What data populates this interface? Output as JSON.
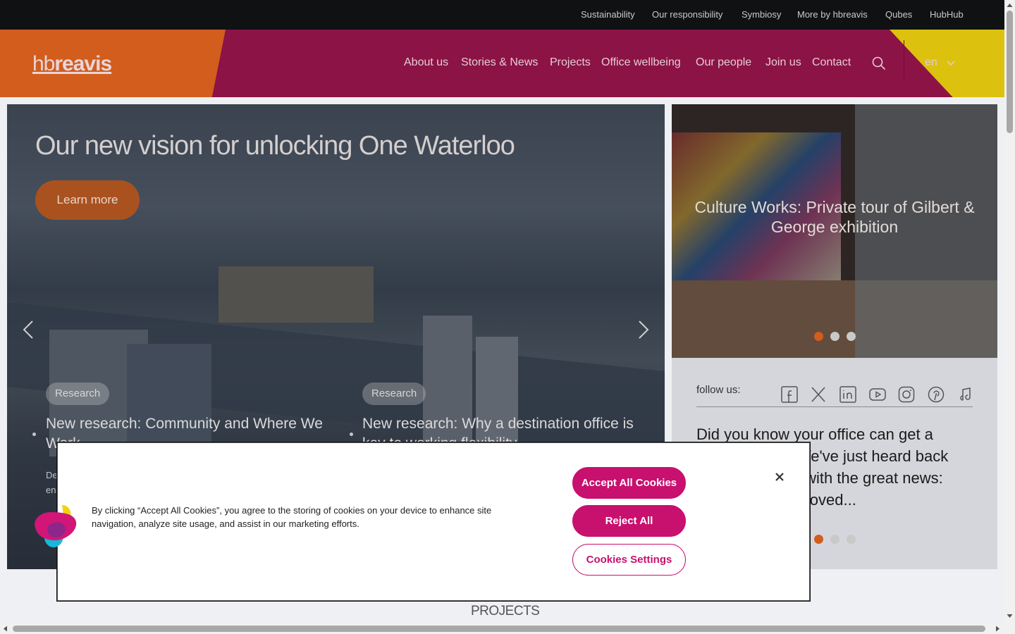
{
  "topbar": {
    "links": [
      "Sustainability",
      "Our responsibility",
      "Symbiosy",
      "More by hbreavis",
      "Qubes",
      "HubHub"
    ]
  },
  "header": {
    "logo_light": "hb",
    "logo_bold": "reavis",
    "nav": [
      "About us",
      "Stories & News",
      "Projects",
      "Office wellbeing",
      "Our people",
      "Join us",
      "Contact"
    ],
    "language": "en"
  },
  "hero": {
    "title": "Our new vision for unlocking One Waterloo",
    "cta_label": "Learn more",
    "stories": [
      {
        "tag": "Research",
        "title": "New research: Community and Where We Work",
        "desc": "De cu en"
      },
      {
        "tag": "Research",
        "title": "New research: Why a destination office is key to working flexibility"
      }
    ]
  },
  "side_card": {
    "title": "Culture Works: Private tour of Gilbert & George exhibition",
    "active_dot": 0
  },
  "follow": {
    "label": "follow us:",
    "socials": [
      "facebook-icon",
      "x-icon",
      "linkedin-icon",
      "youtube-icon",
      "instagram-icon",
      "pinterest-icon",
      "tiktok-icon"
    ],
    "fact": "Did you know your office can get a health check? We've just heard back from the doctor with the great news: we've been approved...",
    "active_dot": 0
  },
  "projects": {
    "title": "PROJECTS"
  },
  "cookie": {
    "text": "By clicking “Accept All Cookies”, you agree to the storing of cookies on your device to enhance site navigation, analyze site usage, and assist in our marketing efforts.",
    "accept_label": "Accept All Cookies",
    "reject_label": "Reject All",
    "settings_label": "Cookies Settings"
  },
  "colors": {
    "brand_magenta": "#c8106e",
    "brand_orange": "#d25d1d",
    "brand_yellow": "#dcc20f",
    "header_bg": "#8c1346"
  }
}
